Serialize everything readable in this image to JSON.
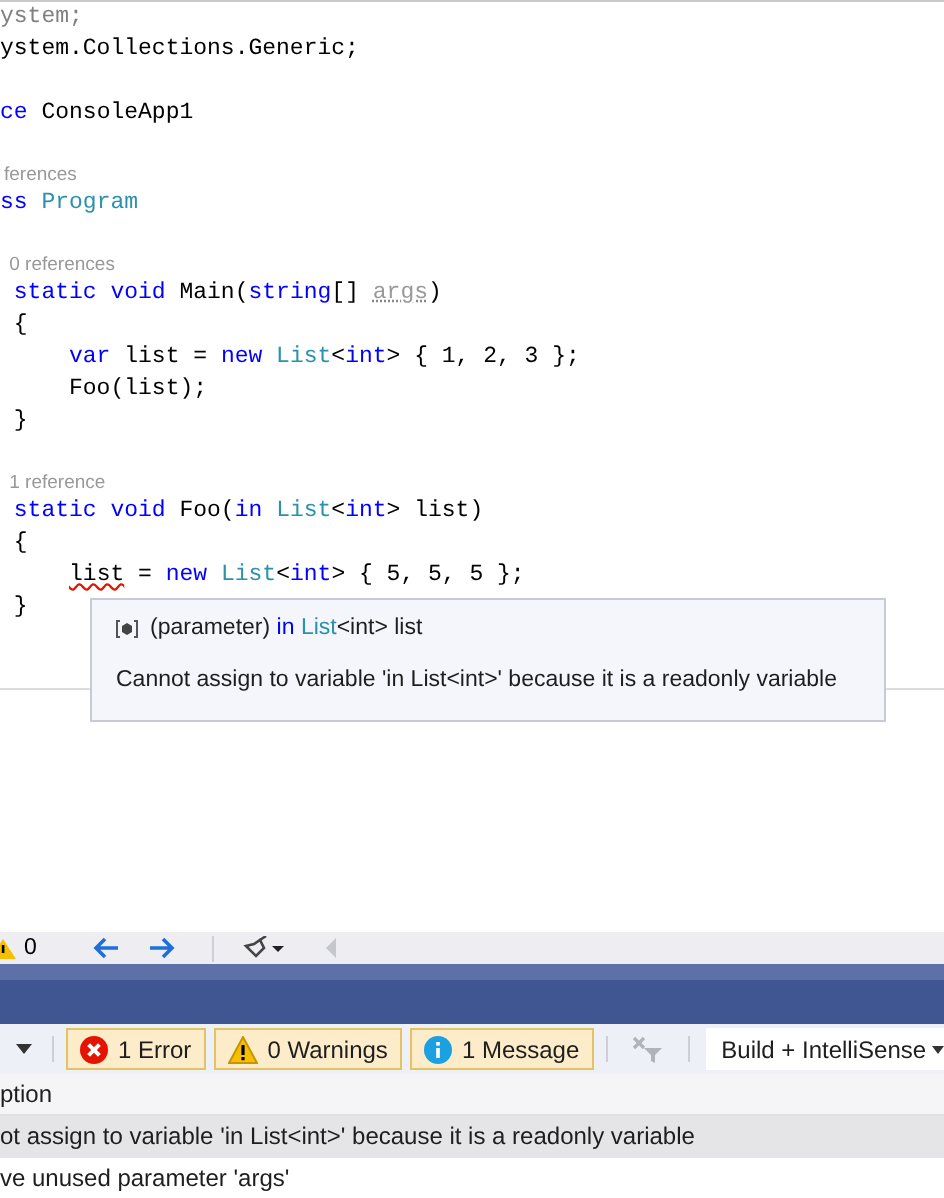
{
  "editor": {
    "lines": [
      {
        "kind": "code",
        "tokens": [
          {
            "text": "ystem;",
            "kind": "faded"
          }
        ]
      },
      {
        "kind": "code",
        "tokens": [
          {
            "text": "ystem.Collections.Generic;",
            "kind": "plain"
          }
        ]
      },
      {
        "kind": "blank"
      },
      {
        "kind": "code",
        "tokens": [
          {
            "text": "ce",
            "kind": "keyword"
          },
          {
            "text": " ConsoleApp1",
            "kind": "plain"
          }
        ]
      },
      {
        "kind": "blank"
      },
      {
        "kind": "lens",
        "tokens": [
          {
            "text": "ferences",
            "kind": "plain"
          }
        ]
      },
      {
        "kind": "code",
        "tokens": [
          {
            "text": "ss",
            "kind": "keyword"
          },
          {
            "text": " Program",
            "kind": "type"
          }
        ]
      },
      {
        "kind": "blank"
      },
      {
        "kind": "lens",
        "tokens": [
          {
            "text": " 0 references",
            "kind": "plain"
          }
        ]
      },
      {
        "kind": "code",
        "tokens": [
          {
            "text": " static void",
            "kind": "keyword"
          },
          {
            "text": " Main(",
            "kind": "plain"
          },
          {
            "text": "string",
            "kind": "keyword"
          },
          {
            "text": "[] ",
            "kind": "plain"
          },
          {
            "text": "args",
            "kind": "unused"
          },
          {
            "text": ")",
            "kind": "plain"
          }
        ]
      },
      {
        "kind": "code",
        "tokens": [
          {
            "text": " {",
            "kind": "plain"
          }
        ]
      },
      {
        "kind": "code",
        "tokens": [
          {
            "text": "     var",
            "kind": "keyword"
          },
          {
            "text": " list = ",
            "kind": "plain"
          },
          {
            "text": "new ",
            "kind": "keyword"
          },
          {
            "text": "List",
            "kind": "type"
          },
          {
            "text": "<",
            "kind": "plain"
          },
          {
            "text": "int",
            "kind": "keyword"
          },
          {
            "text": "> { 1, 2, 3 };",
            "kind": "plain"
          }
        ]
      },
      {
        "kind": "code",
        "tokens": [
          {
            "text": "     Foo(list);",
            "kind": "plain"
          }
        ]
      },
      {
        "kind": "code",
        "tokens": [
          {
            "text": " }",
            "kind": "plain"
          }
        ]
      },
      {
        "kind": "blank"
      },
      {
        "kind": "lens",
        "tokens": [
          {
            "text": " 1 reference",
            "kind": "plain"
          }
        ]
      },
      {
        "kind": "code",
        "tokens": [
          {
            "text": " static void",
            "kind": "keyword"
          },
          {
            "text": " Foo(",
            "kind": "plain"
          },
          {
            "text": "in ",
            "kind": "keyword"
          },
          {
            "text": "List",
            "kind": "type"
          },
          {
            "text": "<",
            "kind": "plain"
          },
          {
            "text": "int",
            "kind": "keyword"
          },
          {
            "text": "> list)",
            "kind": "plain"
          }
        ]
      },
      {
        "kind": "code",
        "tokens": [
          {
            "text": " {",
            "kind": "plain"
          }
        ]
      },
      {
        "kind": "code",
        "tokens": [
          {
            "text": "     list",
            "kind": "error"
          },
          {
            "text": " = ",
            "kind": "plain"
          },
          {
            "text": "new ",
            "kind": "keyword"
          },
          {
            "text": "List",
            "kind": "type"
          },
          {
            "text": "<",
            "kind": "plain"
          },
          {
            "text": "int",
            "kind": "keyword"
          },
          {
            "text": "> { 5, 5, 5 };",
            "kind": "plain"
          }
        ]
      },
      {
        "kind": "code",
        "tokens": [
          {
            "text": " }",
            "kind": "plain"
          }
        ]
      }
    ]
  },
  "quick_info": {
    "signature": [
      {
        "text": "(parameter) ",
        "kind": "plain"
      },
      {
        "text": "in ",
        "kind": "keyword"
      },
      {
        "text": "List",
        "kind": "type"
      },
      {
        "text": "<int> list",
        "kind": "plain"
      }
    ],
    "message": "Cannot assign to variable 'in List<int>' because it is a readonly variable"
  },
  "status_bar": {
    "warning_count": "0"
  },
  "error_list": {
    "filters": [
      {
        "kind": "error",
        "label": "1 Error",
        "selected": true
      },
      {
        "kind": "warning",
        "label": "0 Warnings",
        "selected": true
      },
      {
        "kind": "message",
        "label": "1 Message",
        "selected": true
      }
    ],
    "source": "Build + IntelliSense",
    "columns": [
      "ption"
    ],
    "rows": [
      {
        "text": "ot assign to variable 'in List<int>' because it is a readonly variable",
        "selected": true
      },
      {
        "text": "ve unused parameter 'args'",
        "selected": false
      }
    ]
  }
}
